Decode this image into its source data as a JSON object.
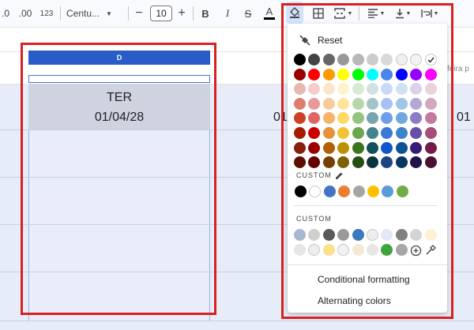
{
  "toolbar": {
    "decimal_decrease_label": ".0",
    "decimal_increase_label": ".00",
    "number_format_label": "123",
    "font_name": "Centu...",
    "font_size": "10",
    "decrease_font_icon": "minus-icon",
    "increase_font_icon": "plus-icon",
    "bold_label": "B",
    "italic_label": "I",
    "strikethrough_label": "S",
    "text_color_label": "A"
  },
  "sheet": {
    "column_header": "D",
    "cell_day": "TER",
    "cell_date": "01/04/28",
    "partial_text_1": "01",
    "partial_text_2": "01",
    "formula_partial": "feira p"
  },
  "fill_menu": {
    "reset_label": "Reset",
    "custom_label_1": "CUSTOM",
    "custom_label_2": "CUSTOM",
    "conditional_label": "Conditional formatting",
    "alternating_label": "Alternating colors",
    "palette": [
      [
        "#000000",
        "#434343",
        "#666666",
        "#999999",
        "#b7b7b7",
        "#cccccc",
        "#d9d9d9",
        "#efefef",
        "#f3f3f3",
        "#ffffff"
      ],
      [
        "#980000",
        "#ff0000",
        "#ff9900",
        "#ffff00",
        "#00ff00",
        "#00ffff",
        "#4a86e8",
        "#0000ff",
        "#9900ff",
        "#ff00ff"
      ],
      [
        "#e6b8af",
        "#f4cccc",
        "#fce5cd",
        "#fff2cc",
        "#d9ead3",
        "#d0e0e3",
        "#c9daf8",
        "#cfe2f3",
        "#d9d2e9",
        "#ead1dc"
      ],
      [
        "#dd7e6b",
        "#ea9999",
        "#f9cb9c",
        "#ffe599",
        "#b6d7a8",
        "#a2c4c9",
        "#a4c2f4",
        "#9fc5e8",
        "#b4a7d6",
        "#d5a6bd"
      ],
      [
        "#cc4125",
        "#e06666",
        "#f6b26b",
        "#ffd966",
        "#93c47d",
        "#76a5af",
        "#6d9eeb",
        "#6fa8dc",
        "#8e7cc3",
        "#c27ba0"
      ],
      [
        "#a61c00",
        "#cc0000",
        "#e69138",
        "#f1c232",
        "#6aa84f",
        "#45818e",
        "#3c78d8",
        "#3d85c6",
        "#674ea7",
        "#a64d79"
      ],
      [
        "#85200c",
        "#990000",
        "#b45f06",
        "#bf9000",
        "#38761d",
        "#134f5c",
        "#1155cc",
        "#0b5394",
        "#351c75",
        "#741b47"
      ],
      [
        "#5b0f00",
        "#660000",
        "#783f04",
        "#7f6000",
        "#274e13",
        "#0c343d",
        "#1c4587",
        "#073763",
        "#20124d",
        "#4c1130"
      ]
    ],
    "custom_row_1": [
      "#000000",
      "#ffffff",
      "#4472c4",
      "#ed7d31",
      "#a5a5a5",
      "#ffc000",
      "#5b9bd5",
      "#70ad47"
    ],
    "custom_row_2a": [
      "#a6b8d0",
      "#cfcfcf",
      "#5a5a5a",
      "#9a9a9a",
      "#3c78c0",
      "#eeeeee",
      "#e0e9f5",
      "#808080",
      "#d4d4d4",
      "#fdf1d5"
    ],
    "custom_row_2b": [
      "#e6e6e6",
      "#eeeeee",
      "#fce08a",
      "#f2f2f2",
      "#f3ead6",
      "#e6e6e6",
      "#3ea43e",
      "#a6a6a6"
    ]
  }
}
